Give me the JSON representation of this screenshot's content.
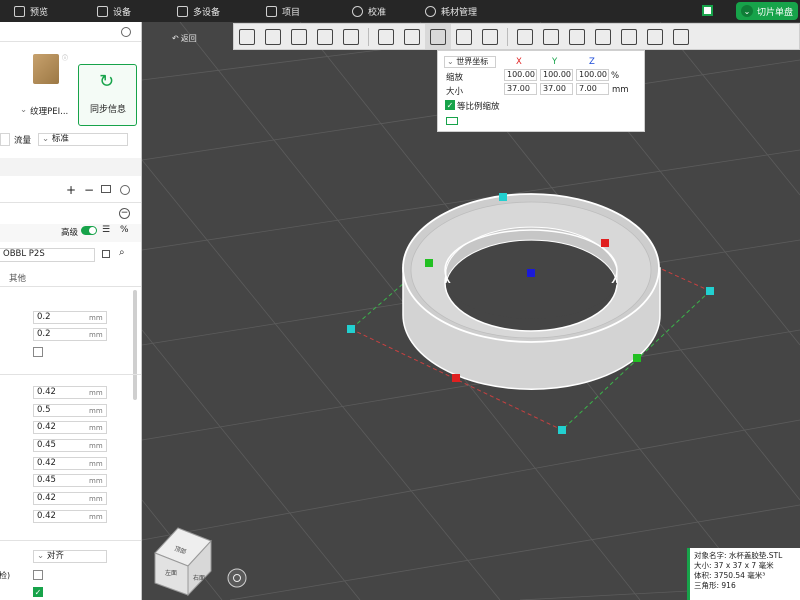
{
  "topbar": {
    "preview": "预览",
    "device": "设备",
    "multi_device": "多设备",
    "project": "项目",
    "calibration": "校准",
    "filament": "耗材管理",
    "slice": "切片单盘"
  },
  "left": {
    "plate_label": "纹理PEI...",
    "sync_label": "同步信息",
    "flow_label": "流量",
    "standard_label": "标准",
    "advanced_label": "高级",
    "printer_name": "OBBL P2S",
    "other_tab": "其他",
    "fields_a": [
      "0.2",
      "0.2"
    ],
    "fields_b": [
      "0.42",
      "0.5",
      "0.42",
      "0.45",
      "0.42",
      "0.45",
      "0.42",
      "0.42"
    ],
    "unit": "mm",
    "align_label": "对齐",
    "cut_text": "检)"
  },
  "viewport": {
    "back": "返回"
  },
  "transform": {
    "coord": "世界坐标",
    "x": "X",
    "y": "Y",
    "z": "Z",
    "scale_label": "缩放",
    "scale": [
      "100.00",
      "100.00",
      "100.00"
    ],
    "scale_unit": "%",
    "size_label": "大小",
    "size": [
      "37.00",
      "37.00",
      "7.00"
    ],
    "size_unit": "mm",
    "uniform_label": "等比例缩放",
    "uniform_checked": true
  },
  "info": {
    "name": "对象名字: 水杯盖胶垫.STL",
    "size": "大小:  37 x 37 x 7 毫米",
    "volume": "体积:  3750.54 毫米³",
    "triangles": "三角形:  916"
  },
  "navcube": {
    "top": "顶部",
    "left": "左面",
    "right": "右面"
  },
  "colors": {
    "accent": "#17a34a",
    "viewport_bg": "#454545",
    "topbar_bg": "#262626"
  }
}
